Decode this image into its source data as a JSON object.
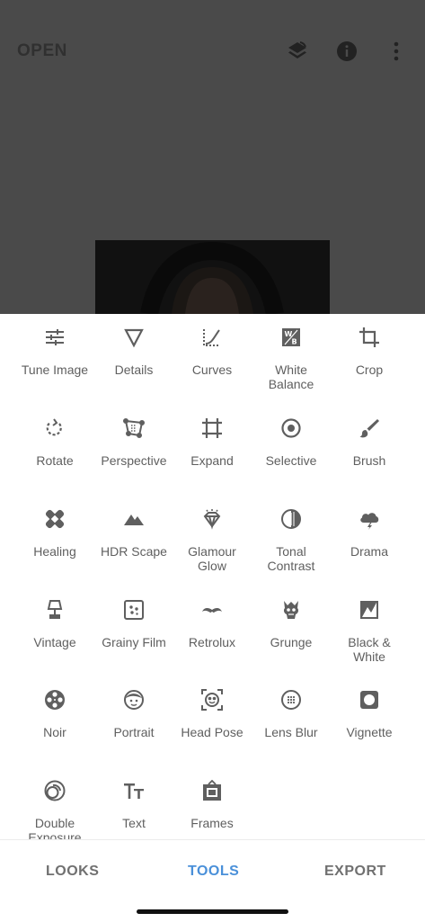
{
  "header": {
    "open_label": "OPEN"
  },
  "tools": [
    {
      "label": "Tune Image",
      "icon": "tune-icon"
    },
    {
      "label": "Details",
      "icon": "details-icon"
    },
    {
      "label": "Curves",
      "icon": "curves-icon"
    },
    {
      "label": "White Balance",
      "icon": "white-balance-icon"
    },
    {
      "label": "Crop",
      "icon": "crop-icon"
    },
    {
      "label": "Rotate",
      "icon": "rotate-icon"
    },
    {
      "label": "Perspective",
      "icon": "perspective-icon"
    },
    {
      "label": "Expand",
      "icon": "expand-icon"
    },
    {
      "label": "Selective",
      "icon": "selective-icon"
    },
    {
      "label": "Brush",
      "icon": "brush-icon"
    },
    {
      "label": "Healing",
      "icon": "healing-icon"
    },
    {
      "label": "HDR Scape",
      "icon": "hdr-scape-icon"
    },
    {
      "label": "Glamour Glow",
      "icon": "glamour-glow-icon"
    },
    {
      "label": "Tonal Contrast",
      "icon": "tonal-contrast-icon"
    },
    {
      "label": "Drama",
      "icon": "drama-icon"
    },
    {
      "label": "Vintage",
      "icon": "vintage-icon"
    },
    {
      "label": "Grainy Film",
      "icon": "grainy-film-icon"
    },
    {
      "label": "Retrolux",
      "icon": "retrolux-icon"
    },
    {
      "label": "Grunge",
      "icon": "grunge-icon"
    },
    {
      "label": "Black & White",
      "icon": "black-white-icon"
    },
    {
      "label": "Noir",
      "icon": "noir-icon"
    },
    {
      "label": "Portrait",
      "icon": "portrait-icon"
    },
    {
      "label": "Head Pose",
      "icon": "head-pose-icon"
    },
    {
      "label": "Lens Blur",
      "icon": "lens-blur-icon"
    },
    {
      "label": "Vignette",
      "icon": "vignette-icon"
    },
    {
      "label": "Double Exposure",
      "icon": "double-exposure-icon"
    },
    {
      "label": "Text",
      "icon": "text-icon"
    },
    {
      "label": "Frames",
      "icon": "frames-icon"
    }
  ],
  "tabs": {
    "looks": "LOOKS",
    "tools": "TOOLS",
    "export": "EXPORT",
    "active": "TOOLS"
  },
  "colors": {
    "accent": "#4a90d9",
    "icon": "#5f5f5f",
    "backdrop": "#4a4a4a"
  }
}
